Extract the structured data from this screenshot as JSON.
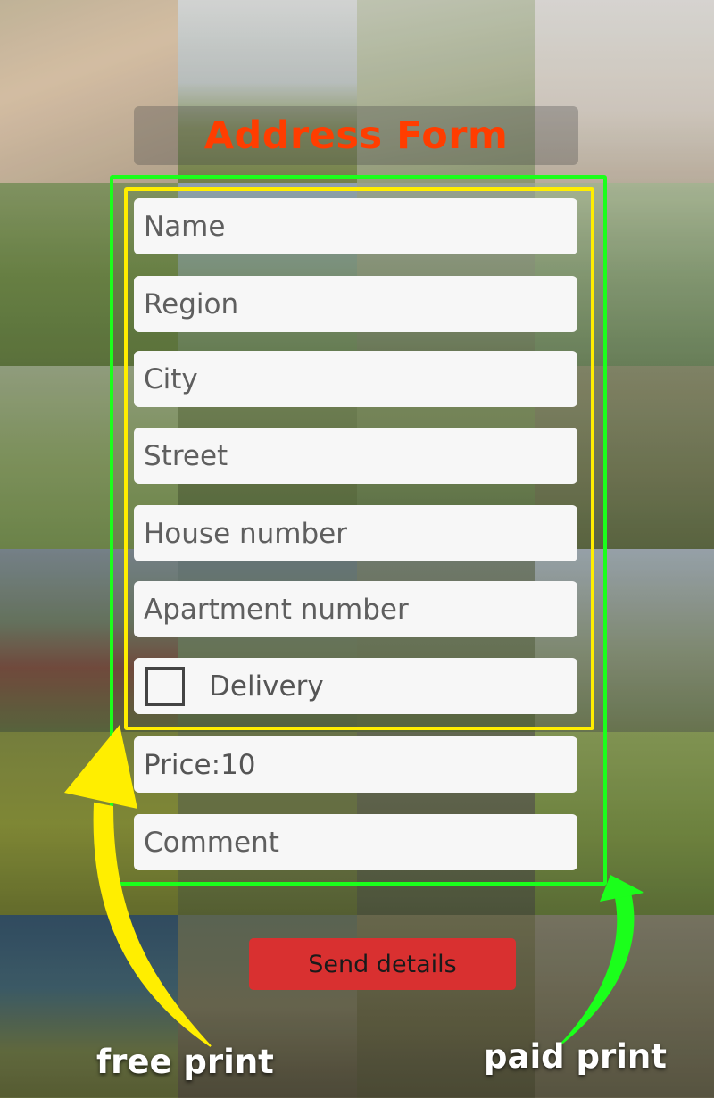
{
  "header": {
    "title": "Address Form"
  },
  "form": {
    "name_placeholder": "Name",
    "region_placeholder": "Region",
    "city_placeholder": "City",
    "street_placeholder": "Street",
    "house_placeholder": "House number",
    "apartment_placeholder": "Apartment number",
    "delivery_label": "Delivery",
    "delivery_checked": false,
    "price_text": "Price:10",
    "comment_placeholder": "Comment",
    "send_label": "Send details"
  },
  "annotations": {
    "free_label": "free print",
    "paid_label": "paid print"
  },
  "colors": {
    "title": "#ff3d00",
    "free_highlight": "#ffee00",
    "paid_highlight": "#1bff1b",
    "send_button": "#d93030"
  },
  "icons": {
    "free_arrow": "yellow-curved-arrow-icon",
    "paid_arrow": "green-curved-arrow-icon"
  }
}
